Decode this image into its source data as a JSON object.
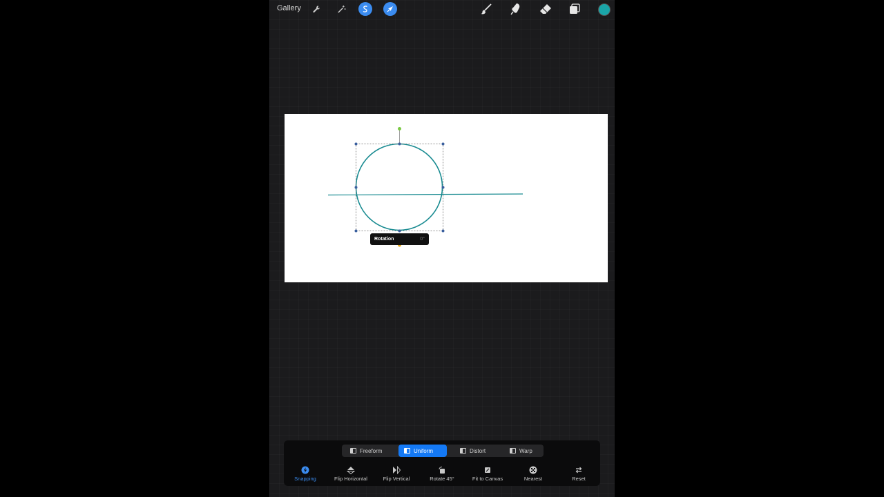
{
  "topbar": {
    "gallery_label": "Gallery",
    "icons": [
      "wrench-icon",
      "magic-wand-icon",
      "selection-icon",
      "transform-arrow-icon",
      "brush-icon",
      "smudge-icon",
      "eraser-icon",
      "layers-icon"
    ],
    "current_color": "#1aa5a8"
  },
  "canvas": {
    "background": "#ffffff",
    "stroke_color": "#198b91",
    "rotation_label": "Rotation",
    "rotation_value": "0°"
  },
  "transform_modes": [
    {
      "label": "Freeform",
      "active": false
    },
    {
      "label": "Uniform",
      "active": true
    },
    {
      "label": "Distort",
      "active": false
    },
    {
      "label": "Warp",
      "active": false
    }
  ],
  "actions": [
    {
      "label": "Snapping",
      "icon": "snapping-icon",
      "active": true
    },
    {
      "label": "Flip Horizontal",
      "icon": "flip-horizontal-icon",
      "active": false
    },
    {
      "label": "Flip Vertical",
      "icon": "flip-vertical-icon",
      "active": false
    },
    {
      "label": "Rotate 45°",
      "icon": "rotate-icon",
      "active": false
    },
    {
      "label": "Fit to Canvas",
      "icon": "fit-to-canvas-icon",
      "active": false
    },
    {
      "label": "Nearest",
      "icon": "nearest-icon",
      "active": false
    },
    {
      "label": "Reset",
      "icon": "reset-icon",
      "active": false
    }
  ]
}
